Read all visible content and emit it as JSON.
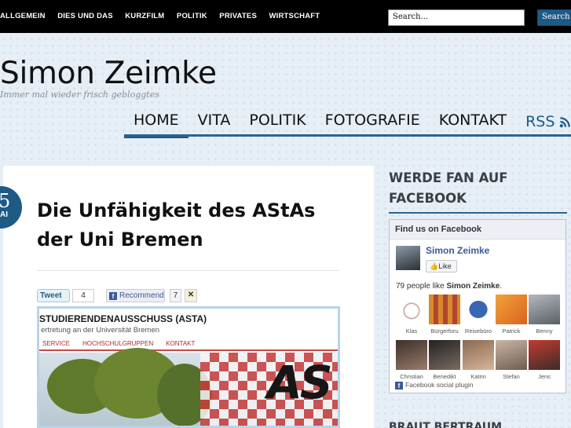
{
  "topnav": {
    "items": [
      "ALLGEMEIN",
      "DIES UND DAS",
      "KURZFILM",
      "POLITIK",
      "PRIVATES",
      "WIRTSCHAFT"
    ]
  },
  "search": {
    "value": "Search...",
    "button_label": "Search"
  },
  "site": {
    "title": "Simon Zeimke",
    "tagline": "Immer mal wieder frisch gebloggtes"
  },
  "mainnav": {
    "items": [
      "HOME",
      "VITA",
      "POLITIK",
      "FOTOGRAFIE",
      "KONTAKT"
    ],
    "rss_label": "RSS",
    "active": "HOME"
  },
  "post": {
    "date_day": "5",
    "date_month": "AI",
    "title": "Die Unfähigkeit des AStAs der Uni Bremen",
    "share": {
      "tweet_label": "Tweet",
      "tweet_count": "4",
      "fb_label": "Recommend",
      "fb_count": "7"
    },
    "image": {
      "heading": "STUDIERENDENAUSSCHUSS (ASTA)",
      "subheading": "ertretung an der Universität Bremen",
      "nav": [
        "SERVICE",
        "HOCHSCHULGRUPPEN",
        "KONTAKT"
      ],
      "logo_text": "AS"
    }
  },
  "sidebar": {
    "widget_title": "WERDE FAN AUF FACEBOOK",
    "facebook": {
      "header": "Find us on Facebook",
      "page_name": "Simon Zeimke",
      "like_label": "Like",
      "count_prefix": "79 people like",
      "count_name": "Simon Zeimke",
      "count_suffix": ".",
      "fans": [
        "Klas",
        "Bürgerforu",
        "Reisebüro",
        "Patrick",
        "Benny",
        "Christian",
        "Benedikt",
        "Katrin",
        "Stefan",
        "Jens"
      ],
      "plugin_label": "Facebook social plugin"
    },
    "next_title": "BRAUT BERTRAUM"
  },
  "colors": {
    "accent": "#1e5a86",
    "facebook": "#3b5998",
    "topbar": "#000000"
  }
}
